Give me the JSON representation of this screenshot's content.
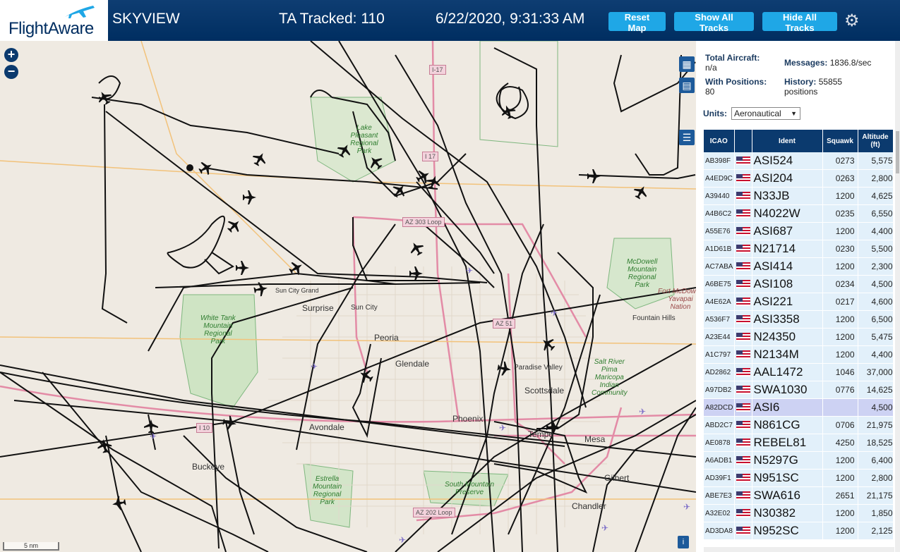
{
  "header": {
    "brand": "FlightAware",
    "app_name": "SKYVIEW",
    "tracked": "TA Tracked: 110",
    "datetime": "6/22/2020, 9:31:33 AM",
    "buttons": {
      "reset": "Reset Map",
      "show": "Show All Tracks",
      "hide": "Hide All Tracks"
    },
    "settings_icon": "gear-icon"
  },
  "map": {
    "zoom_in": "+",
    "zoom_out": "−",
    "scale": "5 nm",
    "places": [
      "Surprise",
      "Sun City",
      "Sun City Grand",
      "Peoria",
      "Glendale",
      "Avondale",
      "Phoenix",
      "Tempe",
      "Mesa",
      "Gilbert",
      "Chandler",
      "Scottsdale",
      "Paradise Valley",
      "Buckeye",
      "Fountain Hills",
      "Lake Pleasant Regional Park"
    ],
    "parks": [
      "White Tank\nMountain\nRegional\nPark",
      "McDowell\nMountain\nRegional\nPark",
      "Estrella\nMountain\nRegional\nPark",
      "South Mountain\nPreserve",
      "Salt River\nPima\nMaricopa\nIndian\nCommunity",
      "Fort McDowell\nYavapai\nNation"
    ],
    "highways": [
      "I-17",
      "I 17",
      "AZ 303 Loop",
      "AZ 51",
      "I 10",
      "AZ 202 Loop"
    ]
  },
  "sidebar": {
    "total_aircraft_label": "Total Aircraft:",
    "total_aircraft_value": "n/a",
    "with_positions_label": "With Positions:",
    "with_positions_value": "80",
    "messages_label": "Messages:",
    "messages_value": "1836.8/sec",
    "history_label": "History:",
    "history_value": "55855",
    "history_unit": "positions",
    "units_label": "Units:",
    "units_value": "Aeronautical",
    "columns": [
      "ICAO",
      "",
      "Ident",
      "Squawk",
      "Altitude (ft)"
    ],
    "rows": [
      [
        "AB398F",
        "ASI524",
        "0273",
        "5,575"
      ],
      [
        "A4ED9C",
        "ASI204",
        "0263",
        "2,800"
      ],
      [
        "A39440",
        "N33JB",
        "1200",
        "4,625"
      ],
      [
        "A4B6C2",
        "N4022W",
        "0235",
        "6,550"
      ],
      [
        "A55E76",
        "ASI687",
        "1200",
        "4,400"
      ],
      [
        "A1D61B",
        "N21714",
        "0230",
        "5,500"
      ],
      [
        "AC7ABA",
        "ASI414",
        "1200",
        "2,300"
      ],
      [
        "A6BE75",
        "ASI108",
        "0234",
        "4,500"
      ],
      [
        "A4E62A",
        "ASI221",
        "0217",
        "4,600"
      ],
      [
        "A536F7",
        "ASI3358",
        "1200",
        "6,500"
      ],
      [
        "A23E44",
        "N24350",
        "1200",
        "5,475"
      ],
      [
        "A1C797",
        "N2134M",
        "1200",
        "4,400"
      ],
      [
        "AD2862",
        "AAL1472",
        "1046",
        "37,000"
      ],
      [
        "A97DB2",
        "SWA1030",
        "0776",
        "14,625"
      ],
      [
        "A82DCD",
        "ASI6",
        "",
        "4,500"
      ],
      [
        "ABD2C7",
        "N861CG",
        "0706",
        "21,975"
      ],
      [
        "AE0878",
        "REBEL81",
        "4250",
        "18,525"
      ],
      [
        "A6ADB1",
        "N5297G",
        "1200",
        "6,400"
      ],
      [
        "AD39F1",
        "N951SC",
        "1200",
        "2,800"
      ],
      [
        "ABE7E3",
        "SWA616",
        "2651",
        "21,175"
      ],
      [
        "A32E02",
        "N30382",
        "1200",
        "1,850"
      ],
      [
        "AD3DA8",
        "N952SC",
        "1200",
        "2,125"
      ]
    ],
    "selected_row": 14
  }
}
